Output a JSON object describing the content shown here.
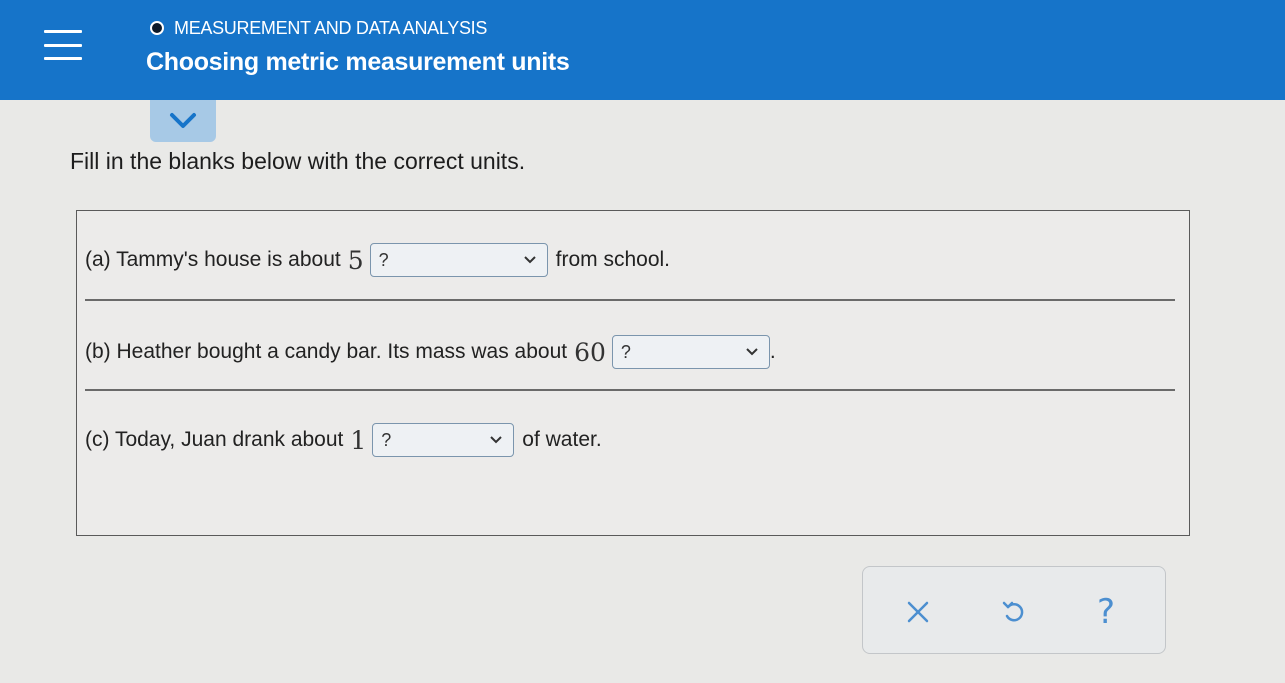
{
  "header": {
    "topic": "MEASUREMENT AND DATA ANALYSIS",
    "title": "Choosing metric measurement units"
  },
  "instructions": "Fill in the blanks below with the correct units.",
  "questions": [
    {
      "prefix": "(a) Tammy's house is about",
      "number": "5",
      "selected": "?",
      "suffix": "from school."
    },
    {
      "prefix": "(b) Heather bought a candy bar. Its mass was about",
      "number": "60",
      "selected": "?",
      "suffix": "."
    },
    {
      "prefix": "(c) Today, Juan drank about",
      "number": "1",
      "selected": "?",
      "suffix": "of water."
    }
  ],
  "actions": {
    "help_label": "?"
  },
  "icons": [
    "menu-icon",
    "chevron-down-icon",
    "close-icon",
    "undo-icon",
    "help-icon"
  ],
  "colors": {
    "header": "#1674c9",
    "tab": "#a7c9e6",
    "accent": "#4c8fd0"
  }
}
